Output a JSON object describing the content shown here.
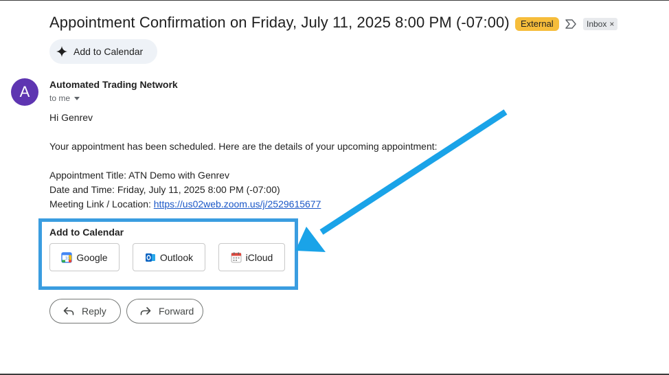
{
  "email": {
    "subject": "Appointment Confirmation on Friday, July 11, 2025 8:00 PM (-07:00)",
    "badges": {
      "external": "External",
      "inbox": "Inbox",
      "inbox_remove": "×"
    },
    "add_to_calendar_chip": "Add to Calendar",
    "sender": {
      "avatar_letter": "A",
      "name": "Automated Trading Network",
      "to": "to me"
    },
    "body": {
      "greeting": "Hi Genrev",
      "intro": "Your appointment has been scheduled. Here are the details of your upcoming appointment:",
      "title_line": "Appointment Title: ATN Demo with Genrev",
      "datetime_line": "Date and Time: Friday, July 11, 2025 8:00 PM (-07:00)",
      "location_label": "Meeting Link / Location: ",
      "location_link": "https://us02web.zoom.us/j/2529615677"
    },
    "calendar_section": {
      "title": "Add to Calendar",
      "buttons": [
        "Google",
        "Outlook",
        "iCloud"
      ]
    },
    "actions": {
      "reply": "Reply",
      "forward": "Forward"
    }
  },
  "colors": {
    "external_badge": "#f6bd3b",
    "avatar": "#5e35b1",
    "annotation_blue": "#3a9de0",
    "link": "#1a57c7"
  },
  "icons": [
    "sparkle-icon",
    "important-marker-icon",
    "google-calendar-icon",
    "outlook-icon",
    "icloud-calendar-icon",
    "reply-icon",
    "forward-icon",
    "annotation-arrow"
  ]
}
